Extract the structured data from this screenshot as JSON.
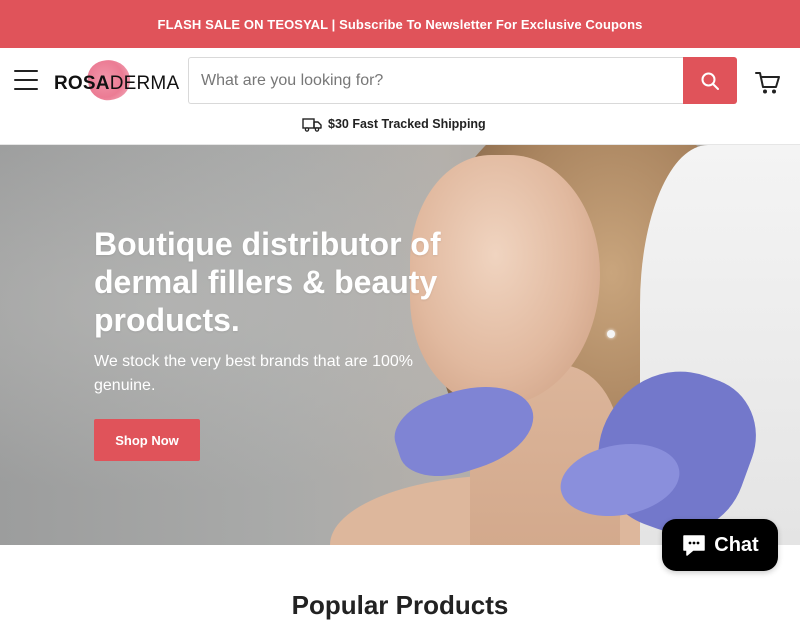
{
  "promo": {
    "text": "FLASH SALE ON TEOSYAL | Subscribe To Newsletter For Exclusive Coupons"
  },
  "header": {
    "logo": {
      "part1": "ROSA",
      "part2": "DERMA"
    },
    "search": {
      "placeholder": "What are you looking for?",
      "value": ""
    },
    "shipping_text": "$30 Fast Tracked Shipping"
  },
  "hero": {
    "title": "Boutique distributor of dermal fillers & beauty products.",
    "subtitle": "We stock the very best brands that are 100% genuine.",
    "button": "Shop Now"
  },
  "section": {
    "heading": "Popular Products"
  },
  "chat": {
    "label": "Chat"
  },
  "colors": {
    "accent": "#e0535a",
    "header_bg": "#ffffff",
    "chat_bg": "#000000"
  },
  "icons": [
    "menu-icon",
    "search-icon",
    "cart-icon",
    "truck-icon",
    "chat-icon"
  ]
}
